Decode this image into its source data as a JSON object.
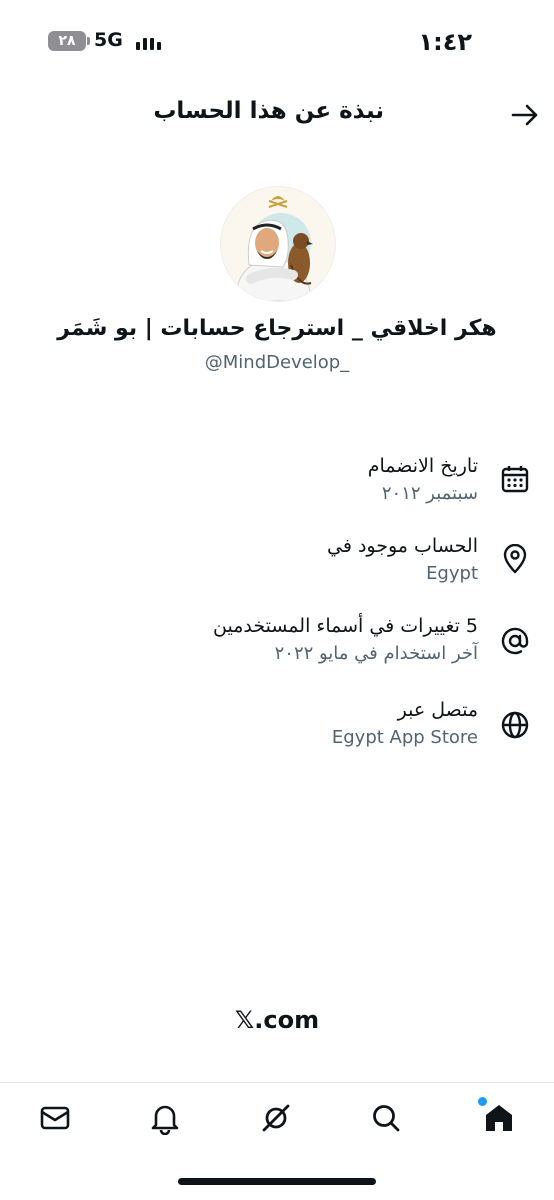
{
  "status_bar": {
    "time": "١:٤٢",
    "battery": "٢٨",
    "network": "5G"
  },
  "header": {
    "title": "نبذة عن هذا الحساب",
    "back_icon": "arrow-right-icon"
  },
  "profile": {
    "display_name": "هكر اخلاقي _ استرجاع حسابات | بو شَمَر",
    "handle": "@MindDevelop_"
  },
  "info": [
    {
      "icon": "calendar-icon",
      "label": "تاريخ الانضمام",
      "value": "سبتمبر ٢٠١٢"
    },
    {
      "icon": "location-pin-icon",
      "label": "الحساب موجود في",
      "value": "Egypt"
    },
    {
      "icon": "at-sign-icon",
      "label": "5 تغييرات في أسماء المستخدمين",
      "value": "آخر استخدام في مايو ٢٠٢٢"
    },
    {
      "icon": "globe-icon",
      "label": "متصل عبر",
      "value": "Egypt App Store"
    }
  ],
  "footer": {
    "logo_text": "𝕏.com"
  },
  "bottom_nav": {
    "items": [
      "mail-icon",
      "bell-icon",
      "grok-icon",
      "search-icon",
      "home-icon"
    ],
    "accent": "#1d9bf0"
  }
}
